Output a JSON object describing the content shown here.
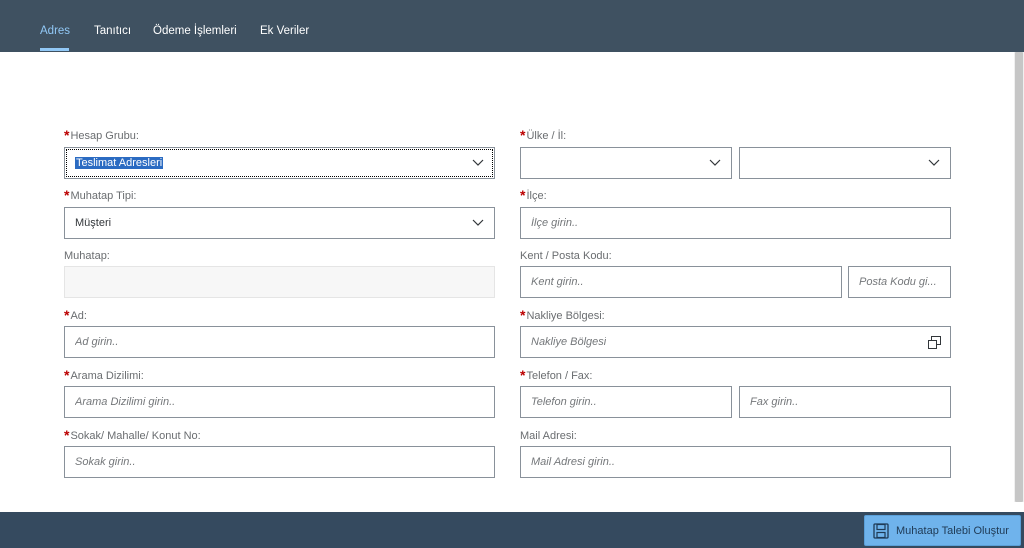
{
  "tabs": [
    {
      "label": "Adres",
      "active": true
    },
    {
      "label": "Tanıtıcı",
      "active": false
    },
    {
      "label": "Ödeme İşlemleri",
      "active": false
    },
    {
      "label": "Ek Veriler",
      "active": false
    }
  ],
  "form": {
    "hesap_grubu": {
      "label": "Hesap Grubu:",
      "required": true,
      "value": "Teslimat Adresleri"
    },
    "muhatap_tipi": {
      "label": "Muhatap Tipi:",
      "required": true,
      "value": "Müşteri"
    },
    "muhatap": {
      "label": "Muhatap:",
      "required": false,
      "value": ""
    },
    "ad": {
      "label": "Ad:",
      "required": true,
      "placeholder": "Ad girin.."
    },
    "arama_dizilimi": {
      "label": "Arama Dizilimi:",
      "required": true,
      "placeholder": "Arama Dizilimi girin.."
    },
    "sokak": {
      "label": "Sokak/ Mahalle/ Konut No:",
      "required": true,
      "placeholder": "Sokak girin.."
    },
    "ulke_il": {
      "label": "Ülke / İl:",
      "required": true,
      "ulke_value": "",
      "il_value": ""
    },
    "ilce": {
      "label": "İlçe:",
      "required": true,
      "placeholder": "İlçe girin.."
    },
    "kent_posta": {
      "label": "Kent / Posta Kodu:",
      "required": false,
      "kent_placeholder": "Kent girin..",
      "posta_placeholder": "Posta Kodu gi..."
    },
    "nakliye": {
      "label": "Nakliye Bölgesi:",
      "required": true,
      "placeholder": "Nakliye Bölgesi"
    },
    "telefon_fax": {
      "label": "Telefon / Fax:",
      "required": true,
      "telefon_placeholder": "Telefon girin..",
      "fax_placeholder": "Fax girin.."
    },
    "mail": {
      "label": "Mail Adresi:",
      "required": false,
      "placeholder": "Mail Adresi girin.."
    }
  },
  "footer": {
    "create_button_label": "Muhatap Talebi Oluştur"
  },
  "colors": {
    "header_bg": "#3f5161",
    "footer_bg": "#354a5f",
    "active_tab": "#91c8f6",
    "required": "#bb0000",
    "button_bg": "#6fb3ec"
  },
  "icons": {
    "dropdown": "chevron-down-icon",
    "value_help": "value-help-icon",
    "button": "save-icon"
  },
  "req_marker": "*"
}
